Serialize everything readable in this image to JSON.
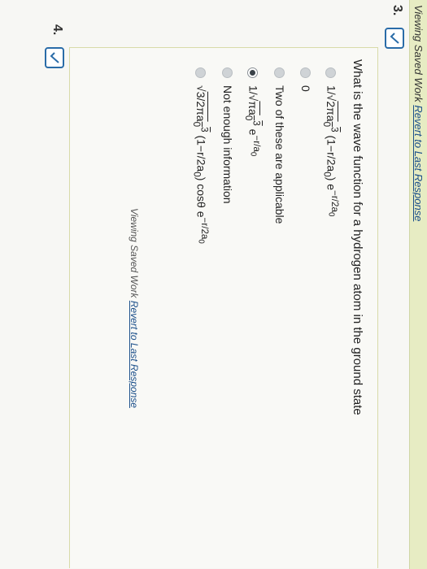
{
  "banner": {
    "saved_text": "Viewing Saved Work",
    "revert_link": "Revert to Last Response"
  },
  "question3": {
    "number": "3.",
    "prompt": "What is the wave function for a hydrogen atom in the ground state",
    "options": [
      {
        "label": "1/√ 2πa₀³ (1−r/2a₀) e^{−r/2a₀}",
        "selected": false
      },
      {
        "label": "0",
        "selected": false
      },
      {
        "label": "Two of these are applicable",
        "selected": false
      },
      {
        "label": "1/√ πa₀³ e^{−r/a₀}",
        "selected": true
      },
      {
        "label": "Not enough information",
        "selected": false
      },
      {
        "label": "√ 3/2πa₀³ (1−r/2a₀) cosθ e^{−r/2a₀}",
        "selected": false
      }
    ],
    "footer_saved_text": "Viewing Saved Work",
    "footer_revert_link": "Revert to Last Response"
  },
  "question4": {
    "number": "4."
  },
  "colors": {
    "banner": "#e7ecc3",
    "link": "#1b4f8a",
    "check_border": "#2a6ca8"
  },
  "icons": {
    "check": "chevron-check-icon"
  }
}
